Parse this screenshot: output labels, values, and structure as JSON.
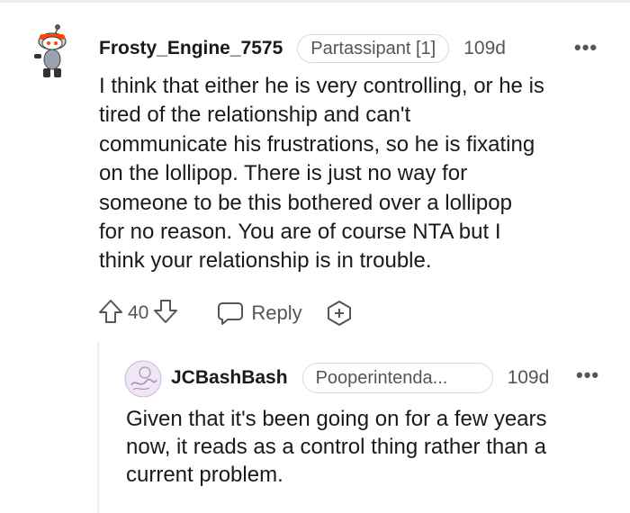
{
  "comment": {
    "username": "Frosty_Engine_7575",
    "flair": "Partassipant [1]",
    "age": "109d",
    "more_label": "•••",
    "body": "I think that either he is very controlling, or he is\ntired of the relationship and can't\ncommunicate his frustrations, so he is fixating\non the lollipop. There is just no way for\nsomeone to be this bothered over a lollipop\nfor no reason. You are of course NTA but I\nthink your relationship is in trouble.",
    "votes": "40",
    "reply_label": "Reply",
    "avatar_icon": "snoo-avatar-icon",
    "accent_color": "#ff4500"
  },
  "reply": {
    "username": "JCBashBash",
    "flair": "Pooperintenda...",
    "age": "109d",
    "more_label": "•••",
    "body": "Given that it's been going on for a few years\nnow, it reads as a control thing rather than a\ncurrent problem.",
    "avatar_icon": "user-avatar-icon",
    "avatar_color": "#c9b8d9"
  }
}
